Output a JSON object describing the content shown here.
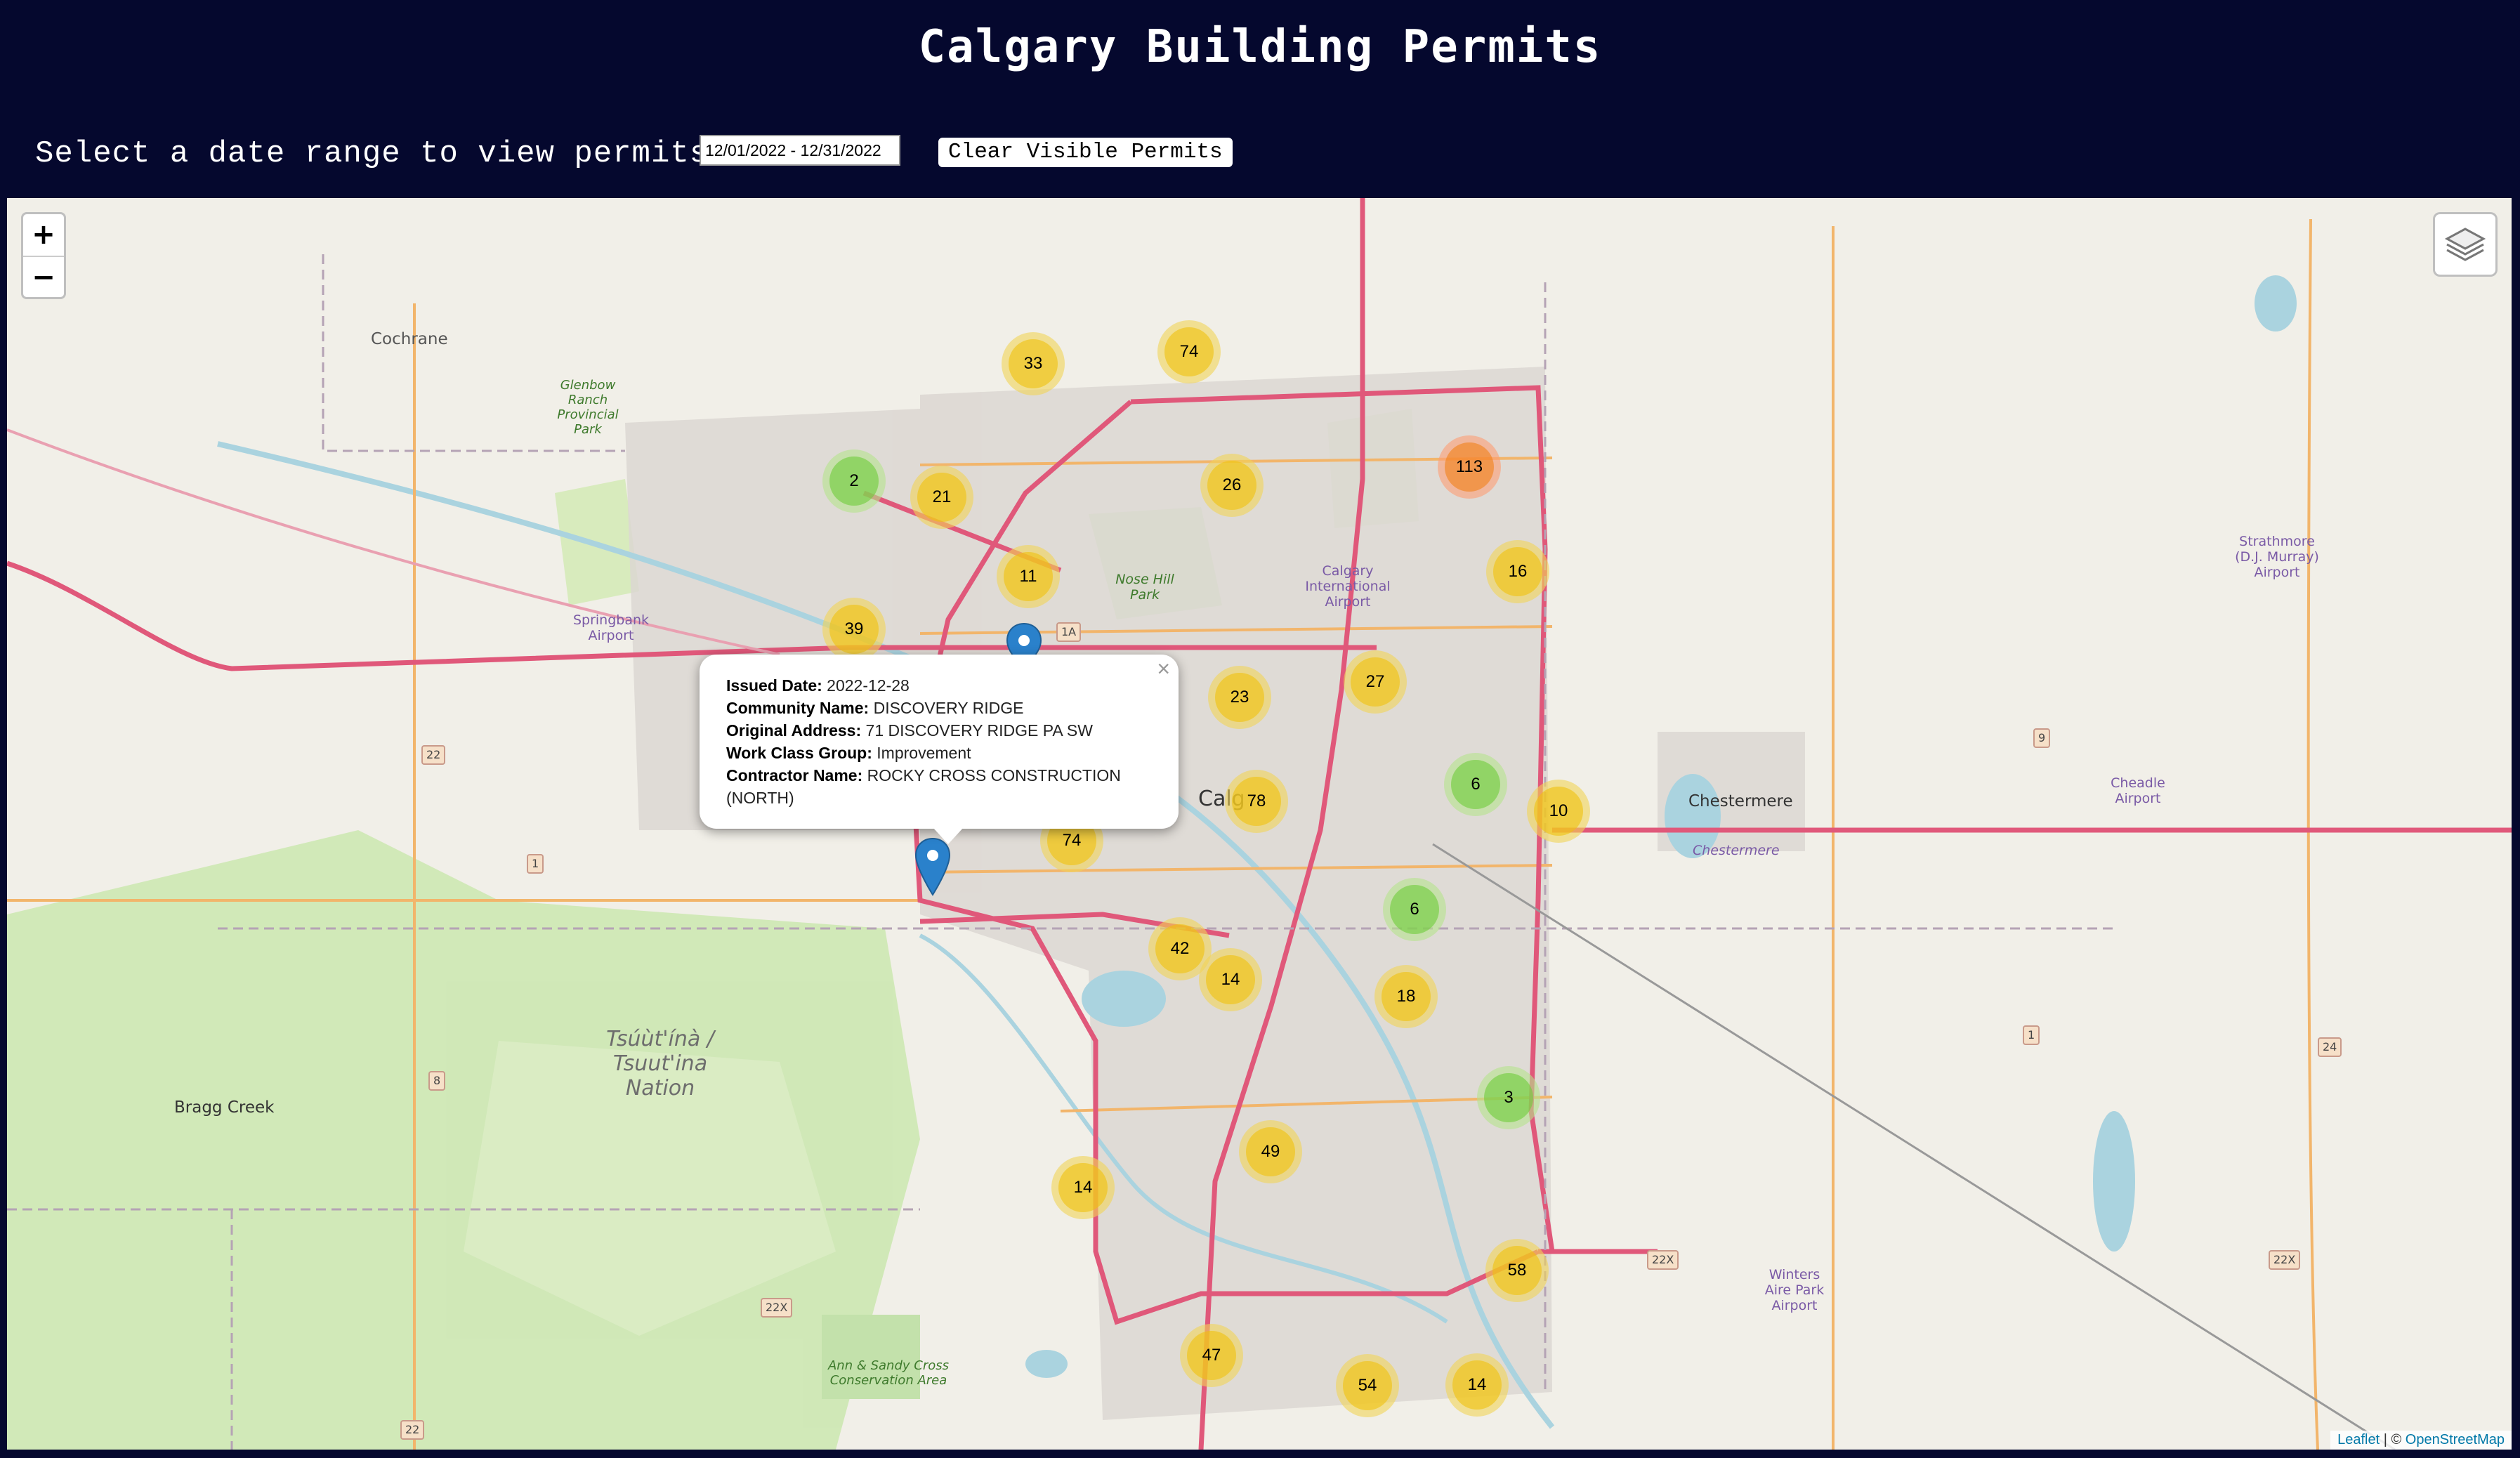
{
  "header": {
    "title": "Calgary Building Permits",
    "date_label": "Select a date range to view permits:",
    "date_range_value": "12/01/2022 - 12/31/2022",
    "clear_button_label": "Clear Visible Permits"
  },
  "map": {
    "zoom_in_label": "+",
    "zoom_out_label": "−",
    "layers_icon": "layers-icon",
    "attribution": {
      "leaflet": "Leaflet",
      "separator": " | © ",
      "osm": "OpenStreetMap"
    },
    "place_labels": {
      "cochrane": "Cochrane",
      "glenbow": "Glenbow Ranch Provincial Park",
      "springbank": "Springbank Airport",
      "nose_hill": "Nose Hill Park",
      "calgary_intl": "Calgary International Airport",
      "calgary": "Calg",
      "chestermere": "Chestermere",
      "chestermere_lake": "Chestermere",
      "strathmore": "Strathmore (D.J. Murray) Airport",
      "cheadle": "Cheadle Airport",
      "tsuutina": "Tsúùt'ínà / Tsuut'ina Nation",
      "bragg_creek": "Bragg Creek",
      "winters": "Winters Aire Park Airport",
      "ann_sandy": "Ann & Sandy Cross Conservation Area"
    },
    "highway_shields": [
      "22",
      "1",
      "8",
      "9",
      "24",
      "22",
      "22X",
      "22X",
      "1",
      "22X",
      "1A"
    ],
    "clusters": [
      {
        "count": "33",
        "level": "medium"
      },
      {
        "count": "74",
        "level": "medium"
      },
      {
        "count": "2",
        "level": "small"
      },
      {
        "count": "21",
        "level": "medium"
      },
      {
        "count": "26",
        "level": "medium"
      },
      {
        "count": "113",
        "level": "large"
      },
      {
        "count": "11",
        "level": "medium"
      },
      {
        "count": "16",
        "level": "medium"
      },
      {
        "count": "39",
        "level": "medium"
      },
      {
        "count": "23",
        "level": "medium"
      },
      {
        "count": "27",
        "level": "medium"
      },
      {
        "count": "6",
        "level": "small"
      },
      {
        "count": "10",
        "level": "medium"
      },
      {
        "count": "78",
        "level": "medium"
      },
      {
        "count": "74",
        "level": "medium"
      },
      {
        "count": "6",
        "level": "small"
      },
      {
        "count": "42",
        "level": "medium"
      },
      {
        "count": "14",
        "level": "medium"
      },
      {
        "count": "18",
        "level": "medium"
      },
      {
        "count": "3",
        "level": "small"
      },
      {
        "count": "49",
        "level": "medium"
      },
      {
        "count": "14",
        "level": "medium"
      },
      {
        "count": "58",
        "level": "medium"
      },
      {
        "count": "47",
        "level": "medium"
      },
      {
        "count": "54",
        "level": "medium"
      },
      {
        "count": "14",
        "level": "medium"
      }
    ],
    "popup": {
      "close": "×",
      "issued_date_label": "Issued Date:",
      "issued_date": "2022-12-28",
      "community_label": "Community Name:",
      "community": "DISCOVERY RIDGE",
      "address_label": "Original Address:",
      "address": "71 DISCOVERY RIDGE PA SW",
      "work_class_label": "Work Class Group:",
      "work_class": "Improvement",
      "contractor_label": "Contractor Name:",
      "contractor": "ROCKY CROSS CONSTRUCTION (NORTH)"
    }
  },
  "colors": {
    "header_bg": "#05082e",
    "map_bg": "#f1efe8",
    "major_road": "#e0587a",
    "arterial": "#f2b56b",
    "marker_blue": "#2a81cb"
  }
}
